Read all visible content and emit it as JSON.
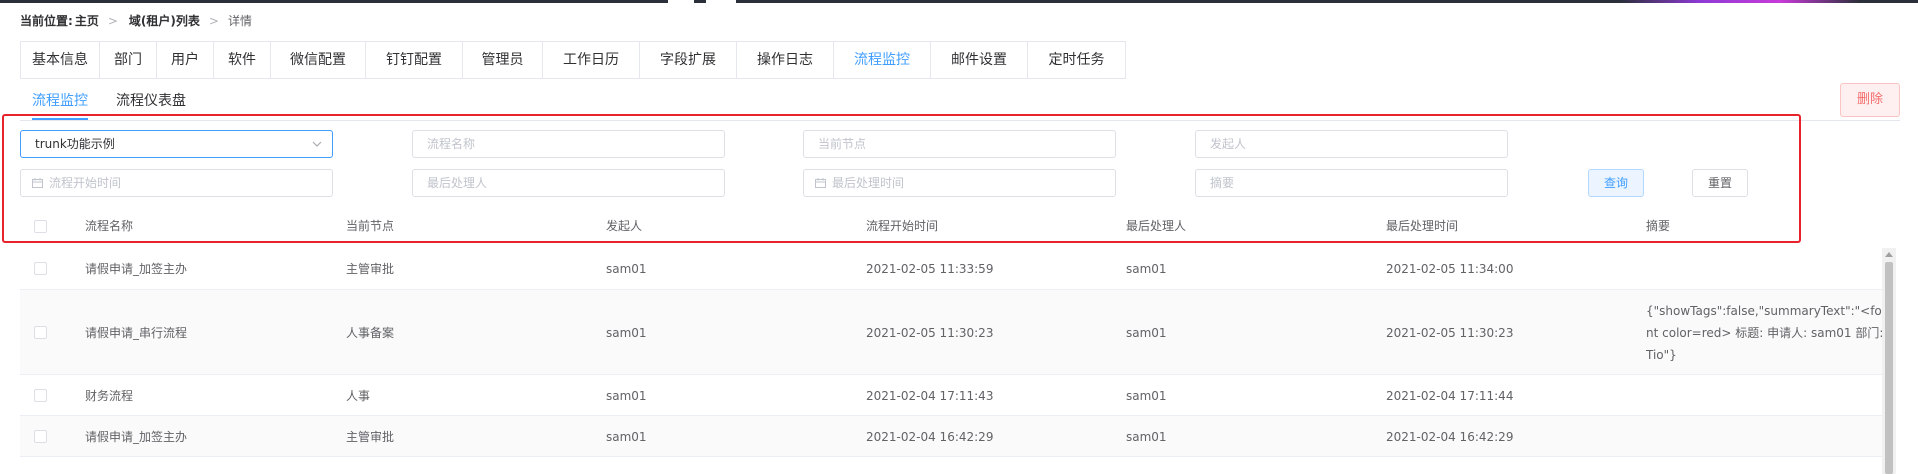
{
  "breadcrumb": {
    "label": "当前位置:",
    "home": "主页",
    "list": "域(租户)列表",
    "current": "详情"
  },
  "tabs": [
    {
      "label": "基本信息"
    },
    {
      "label": "部门"
    },
    {
      "label": "用户"
    },
    {
      "label": "软件"
    },
    {
      "label": "微信配置"
    },
    {
      "label": "钉钉配置"
    },
    {
      "label": "管理员"
    },
    {
      "label": "工作日历"
    },
    {
      "label": "字段扩展"
    },
    {
      "label": "操作日志"
    },
    {
      "label": "流程监控"
    },
    {
      "label": "邮件设置"
    },
    {
      "label": "定时任务"
    }
  ],
  "active_tab": "流程监控",
  "subtabs": [
    {
      "label": "流程监控"
    },
    {
      "label": "流程仪表盘"
    }
  ],
  "active_subtab": "流程监控",
  "delete_label": "删除",
  "filters": {
    "process_select_value": "trunk功能示例",
    "process_name_placeholder": "流程名称",
    "current_node_placeholder": "当前节点",
    "initiator_placeholder": "发起人",
    "start_time_placeholder": "流程开始时间",
    "last_handler_placeholder": "最后处理人",
    "last_handle_time_placeholder": "最后处理时间",
    "summary_placeholder": "摘要",
    "query_label": "查询",
    "reset_label": "重置"
  },
  "table": {
    "columns": [
      "流程名称",
      "当前节点",
      "发起人",
      "流程开始时间",
      "最后处理人",
      "最后处理时间",
      "摘要"
    ],
    "rows": [
      {
        "name": "请假申请_加签主办",
        "node": "主管审批",
        "initiator": "sam01",
        "start": "2021-02-05 11:33:59",
        "handler": "sam01",
        "handled": "2021-02-05 11:34:00",
        "summary": ""
      },
      {
        "name": "请假申请_串行流程",
        "node": "人事备案",
        "initiator": "sam01",
        "start": "2021-02-05 11:30:23",
        "handler": "sam01",
        "handled": "2021-02-05 11:30:23",
        "summary": "{\"showTags\":false,\"summaryText\":\"<font color=red> 标题: 申请人: sam01 部门: Tio\"}"
      },
      {
        "name": "财务流程",
        "node": "人事",
        "initiator": "sam01",
        "start": "2021-02-04 17:11:43",
        "handler": "sam01",
        "handled": "2021-02-04 17:11:44",
        "summary": ""
      },
      {
        "name": "请假申请_加签主办",
        "node": "主管审批",
        "initiator": "sam01",
        "start": "2021-02-04 16:42:29",
        "handler": "sam01",
        "handled": "2021-02-04 16:42:29",
        "summary": ""
      }
    ]
  },
  "colors": {
    "accent": "#409eff",
    "danger": "#f56c6c",
    "highlight_box": "#e8222b"
  },
  "icons": {
    "select_arrow": "chevron-down-icon",
    "date": "calendar-icon"
  }
}
